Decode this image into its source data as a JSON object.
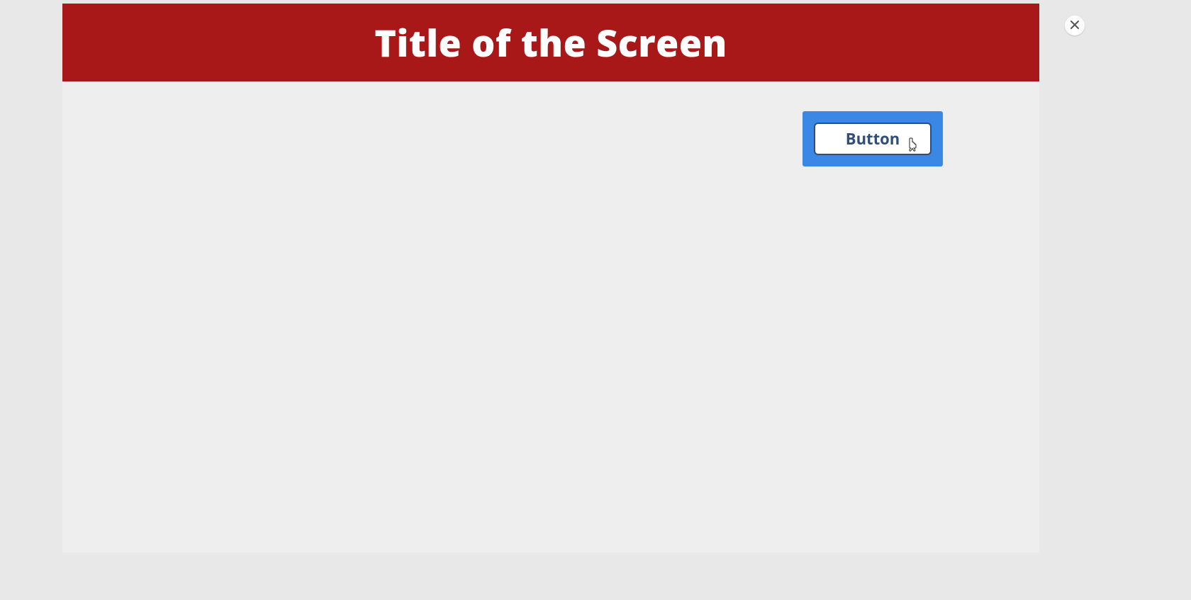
{
  "header": {
    "title": "Title of the Screen"
  },
  "main": {
    "button_label": "Button"
  },
  "colors": {
    "header_bg": "#a81818",
    "highlight": "#3a87e6",
    "button_text": "#2f4f7a",
    "page_bg": "#e8e8e8",
    "panel_bg": "#eeeeee"
  }
}
